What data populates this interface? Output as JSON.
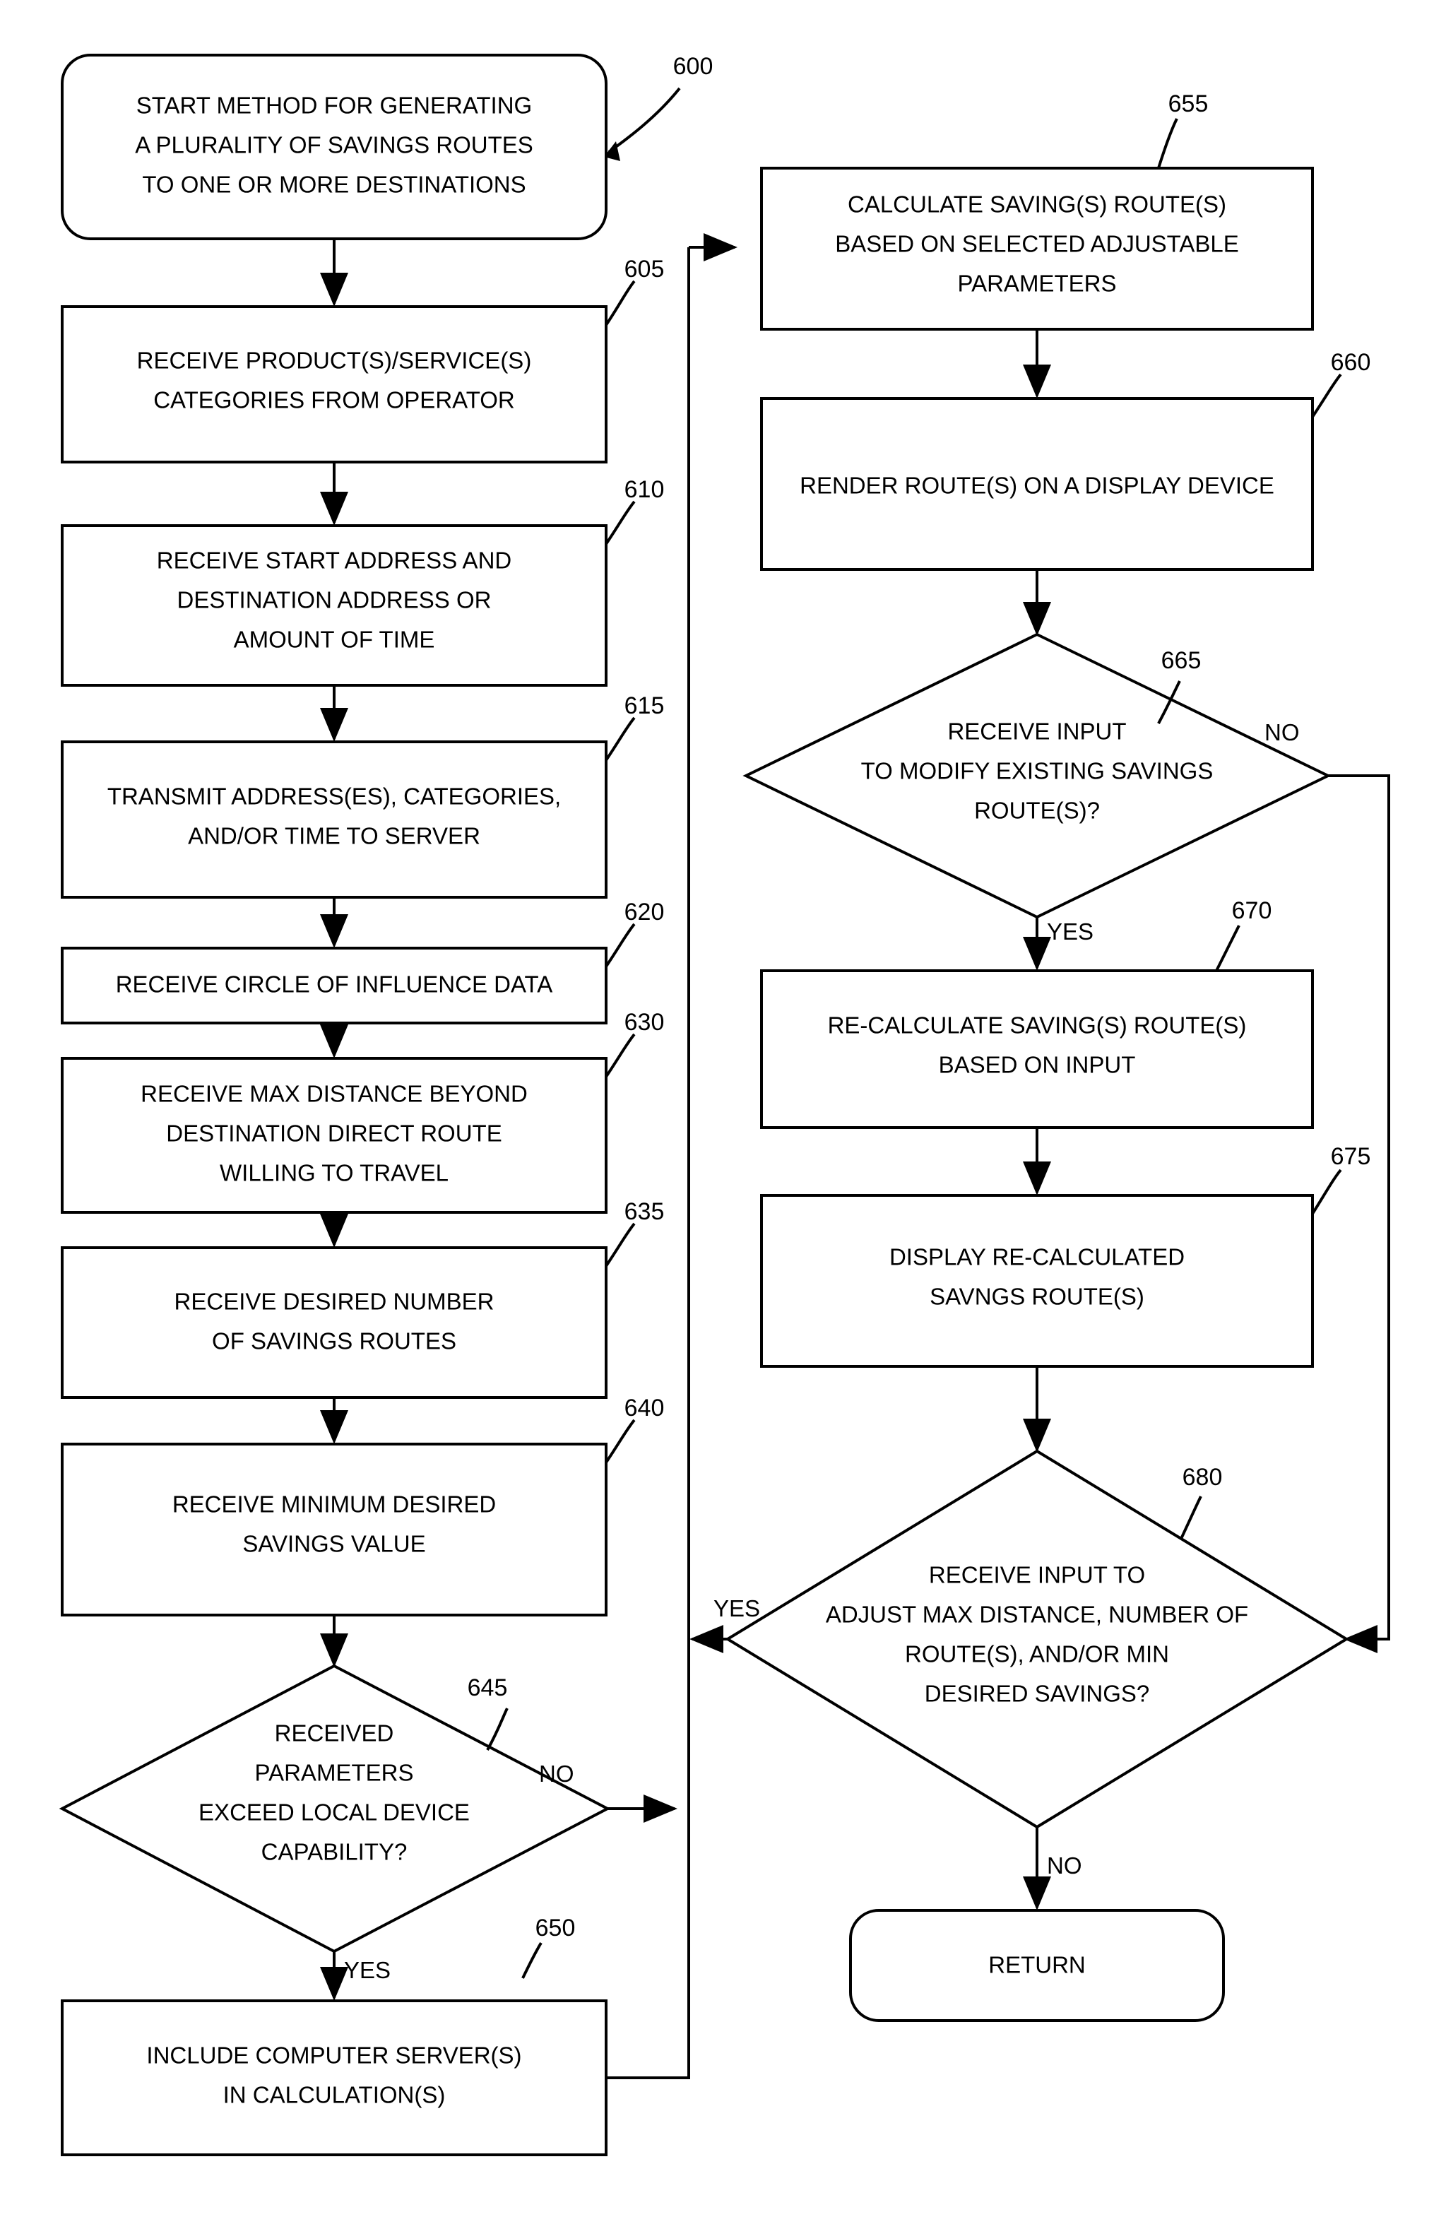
{
  "figure": {
    "number": "600"
  },
  "nodes": {
    "start": {
      "ref": "",
      "lines": [
        "START METHOD FOR GENERATING",
        "A PLURALITY OF SAVINGS ROUTES",
        "TO ONE OR MORE DESTINATIONS"
      ]
    },
    "n605": {
      "ref": "605",
      "lines": [
        "RECEIVE PRODUCT(S)/SERVICE(S)",
        "CATEGORIES FROM OPERATOR"
      ]
    },
    "n610": {
      "ref": "610",
      "lines": [
        "RECEIVE START ADDRESS AND",
        "DESTINATION ADDRESS OR",
        "AMOUNT OF TIME"
      ]
    },
    "n615": {
      "ref": "615",
      "lines": [
        "TRANSMIT ADDRESS(ES), CATEGORIES,",
        "AND/OR TIME TO SERVER"
      ]
    },
    "n620": {
      "ref": "620",
      "lines": [
        "RECEIVE CIRCLE OF INFLUENCE DATA"
      ]
    },
    "n630": {
      "ref": "630",
      "lines": [
        "RECEIVE MAX DISTANCE BEYOND",
        "DESTINATION DIRECT ROUTE",
        "WILLING TO TRAVEL"
      ]
    },
    "n635": {
      "ref": "635",
      "lines": [
        "RECEIVE DESIRED NUMBER",
        "OF SAVINGS ROUTES"
      ]
    },
    "n640": {
      "ref": "640",
      "lines": [
        "RECEIVE MINIMUM DESIRED",
        "SAVINGS VALUE"
      ]
    },
    "n645": {
      "ref": "645",
      "lines": [
        "RECEIVED",
        "PARAMETERS",
        "EXCEED LOCAL DEVICE",
        "CAPABILITY?"
      ]
    },
    "n650": {
      "ref": "650",
      "lines": [
        "INCLUDE COMPUTER SERVER(S)",
        "IN CALCULATION(S)"
      ]
    },
    "n655": {
      "ref": "655",
      "lines": [
        "CALCULATE SAVING(S) ROUTE(S)",
        "BASED ON SELECTED ADJUSTABLE",
        "PARAMETERS"
      ]
    },
    "n660": {
      "ref": "660",
      "lines": [
        "RENDER ROUTE(S) ON A DISPLAY DEVICE"
      ]
    },
    "n665": {
      "ref": "665",
      "lines": [
        "RECEIVE INPUT",
        "TO MODIFY EXISTING SAVINGS",
        "ROUTE(S)?"
      ]
    },
    "n670": {
      "ref": "670",
      "lines": [
        "RE-CALCULATE SAVING(S) ROUTE(S)",
        "BASED ON INPUT"
      ]
    },
    "n675": {
      "ref": "675",
      "lines": [
        "DISPLAY RE-CALCULATED",
        "SAVNGS ROUTE(S)"
      ]
    },
    "n680": {
      "ref": "680",
      "lines": [
        "RECEIVE INPUT TO",
        "ADJUST MAX DISTANCE, NUMBER OF",
        "ROUTE(S), AND/OR MIN",
        "DESIRED SAVINGS?"
      ]
    },
    "return": {
      "ref": "",
      "lines": [
        "RETURN"
      ]
    }
  },
  "edge_labels": {
    "n645_no": "NO",
    "n645_yes": "YES",
    "n665_no": "NO",
    "n665_yes": "YES",
    "n680_yes": "YES",
    "n680_no": "NO"
  }
}
